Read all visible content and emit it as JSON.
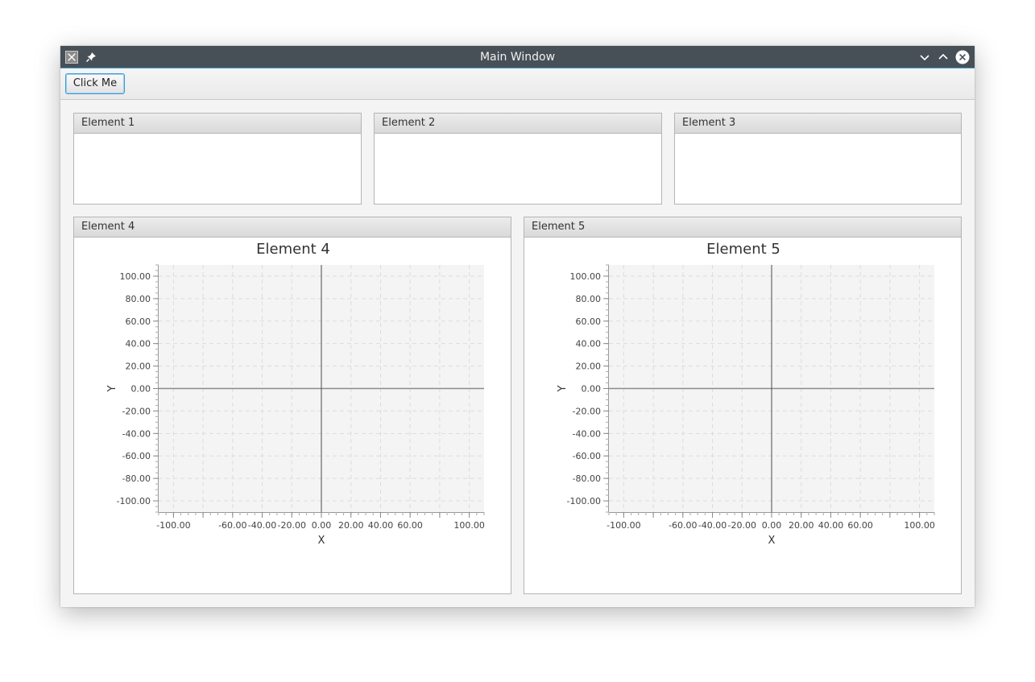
{
  "window": {
    "title": "Main Window",
    "icons": [
      "app-icon",
      "pin-icon",
      "minimize-icon",
      "maximize-icon",
      "close-icon"
    ]
  },
  "toolbar": {
    "button_label": "Click Me"
  },
  "panels": {
    "element1": {
      "title": "Element 1"
    },
    "element2": {
      "title": "Element 2"
    },
    "element3": {
      "title": "Element 3"
    },
    "element4": {
      "title": "Element 4"
    },
    "element5": {
      "title": "Element 5"
    }
  },
  "chart_data": [
    {
      "type": "scatter",
      "title": "Element 4",
      "xlabel": "X",
      "ylabel": "Y",
      "xlim": [
        -110,
        110
      ],
      "ylim": [
        -110,
        110
      ],
      "x_ticks": [
        "-100.00",
        "-60.00",
        "-40.00",
        "-20.00",
        "0.00",
        "20.00",
        "40.00",
        "60.00",
        "100.00"
      ],
      "x_tick_values": [
        -100,
        -60,
        -40,
        -20,
        0,
        20,
        40,
        60,
        100
      ],
      "y_ticks": [
        "100.00",
        "80.00",
        "60.00",
        "40.00",
        "20.00",
        "0.00",
        "-20.00",
        "-40.00",
        "-60.00",
        "-80.00",
        "-100.00"
      ],
      "y_tick_values": [
        100,
        80,
        60,
        40,
        20,
        0,
        -20,
        -40,
        -60,
        -80,
        -100
      ],
      "grid": true,
      "series": []
    },
    {
      "type": "scatter",
      "title": "Element 5",
      "xlabel": "X",
      "ylabel": "Y",
      "xlim": [
        -110,
        110
      ],
      "ylim": [
        -110,
        110
      ],
      "x_ticks": [
        "-100.00",
        "-60.00",
        "-40.00",
        "-20.00",
        "0.00",
        "20.00",
        "40.00",
        "60.00",
        "100.00"
      ],
      "x_tick_values": [
        -100,
        -60,
        -40,
        -20,
        0,
        20,
        40,
        60,
        100
      ],
      "y_ticks": [
        "100.00",
        "80.00",
        "60.00",
        "40.00",
        "20.00",
        "0.00",
        "-20.00",
        "-40.00",
        "-60.00",
        "-80.00",
        "-100.00"
      ],
      "y_tick_values": [
        100,
        80,
        60,
        40,
        20,
        0,
        -20,
        -40,
        -60,
        -80,
        -100
      ],
      "grid": true,
      "series": []
    }
  ],
  "colors": {
    "titlebar": "#475057",
    "focus_accent": "#3a9bd4",
    "plot_background": "#f4f4f4",
    "grid": "#dcdcdc",
    "zero_line_x": "#8c8c8c",
    "zero_line_y": "#4a4a4a"
  }
}
